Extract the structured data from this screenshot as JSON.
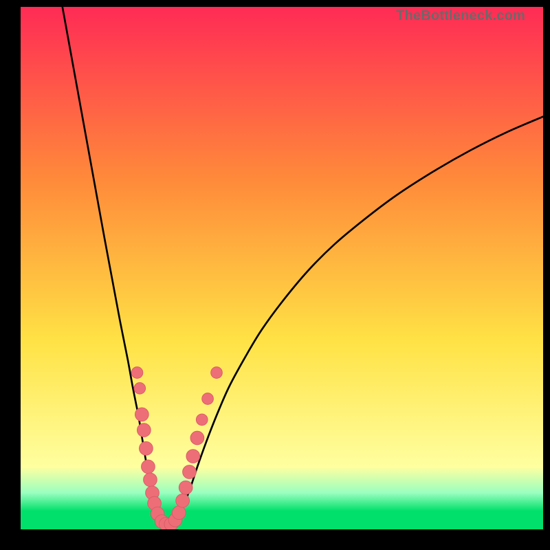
{
  "watermark": "TheBottleneck.com",
  "colors": {
    "frame": "#000000",
    "curve": "#000000",
    "dot_fill": "#ee6e78",
    "dot_stroke": "#d95a65",
    "grad_top": "#ff2b55",
    "grad_mid1": "#ff8a3a",
    "grad_mid2": "#ffe245",
    "grad_yellow_pale": "#ffffa0",
    "grad_green_pale": "#9affc0",
    "grad_green": "#00e06a",
    "watermark": "#6a6a6a"
  },
  "chart_data": {
    "type": "line",
    "title": "",
    "xlabel": "",
    "ylabel": "",
    "xlim": [
      0,
      100
    ],
    "ylim": [
      0,
      100
    ],
    "series": [
      {
        "name": "left-branch",
        "x": [
          8,
          10,
          12,
          14,
          16,
          17.5,
          19,
          20.5,
          21.5,
          22.5,
          23,
          23.5,
          24,
          24.5,
          25,
          25.5,
          26,
          26.35
        ],
        "y": [
          100,
          89,
          78,
          67,
          56,
          48,
          40,
          32.5,
          27,
          22,
          19,
          16,
          13,
          10.5,
          8,
          5.5,
          3,
          1.2
        ]
      },
      {
        "name": "valley-floor",
        "x": [
          26.35,
          27.0,
          28.0,
          29.0,
          29.8
        ],
        "y": [
          1.2,
          0.7,
          0.6,
          0.7,
          1.2
        ]
      },
      {
        "name": "right-branch",
        "x": [
          29.8,
          31,
          32.5,
          34,
          36,
          38,
          40,
          43,
          46,
          50,
          55,
          60,
          66,
          72,
          79,
          86,
          93,
          100
        ],
        "y": [
          1.2,
          4,
          8,
          12.5,
          18,
          23,
          27.5,
          33,
          38,
          43.5,
          49.5,
          54.5,
          59.5,
          64,
          68.5,
          72.5,
          76,
          79
        ]
      }
    ],
    "scatter": {
      "name": "dots",
      "points": [
        {
          "x": 22.3,
          "y": 30.0,
          "r": 1.1
        },
        {
          "x": 22.8,
          "y": 27.0,
          "r": 1.1
        },
        {
          "x": 23.2,
          "y": 22.0,
          "r": 1.3
        },
        {
          "x": 23.6,
          "y": 19.0,
          "r": 1.3
        },
        {
          "x": 24.0,
          "y": 15.5,
          "r": 1.3
        },
        {
          "x": 24.4,
          "y": 12.0,
          "r": 1.3
        },
        {
          "x": 24.8,
          "y": 9.5,
          "r": 1.3
        },
        {
          "x": 25.2,
          "y": 7.0,
          "r": 1.3
        },
        {
          "x": 25.6,
          "y": 5.0,
          "r": 1.3
        },
        {
          "x": 26.2,
          "y": 3.0,
          "r": 1.3
        },
        {
          "x": 27.0,
          "y": 1.5,
          "r": 1.3
        },
        {
          "x": 27.8,
          "y": 1.0,
          "r": 1.3
        },
        {
          "x": 28.8,
          "y": 1.0,
          "r": 1.3
        },
        {
          "x": 29.6,
          "y": 1.8,
          "r": 1.3
        },
        {
          "x": 30.3,
          "y": 3.2,
          "r": 1.3
        },
        {
          "x": 31.0,
          "y": 5.5,
          "r": 1.3
        },
        {
          "x": 31.6,
          "y": 8.0,
          "r": 1.3
        },
        {
          "x": 32.3,
          "y": 11.0,
          "r": 1.3
        },
        {
          "x": 33.0,
          "y": 14.0,
          "r": 1.3
        },
        {
          "x": 33.8,
          "y": 17.5,
          "r": 1.3
        },
        {
          "x": 34.7,
          "y": 21.0,
          "r": 1.1
        },
        {
          "x": 35.8,
          "y": 25.0,
          "r": 1.1
        },
        {
          "x": 37.5,
          "y": 30.0,
          "r": 1.1
        }
      ]
    },
    "gradient_stops": [
      {
        "offset": 0.0,
        "color": "#ff2b55"
      },
      {
        "offset": 0.33,
        "color": "#ff8a3a"
      },
      {
        "offset": 0.64,
        "color": "#ffe245"
      },
      {
        "offset": 0.88,
        "color": "#ffffa0"
      },
      {
        "offset": 0.93,
        "color": "#9affc0"
      },
      {
        "offset": 0.965,
        "color": "#00e06a"
      },
      {
        "offset": 1.0,
        "color": "#00e06a"
      }
    ]
  }
}
